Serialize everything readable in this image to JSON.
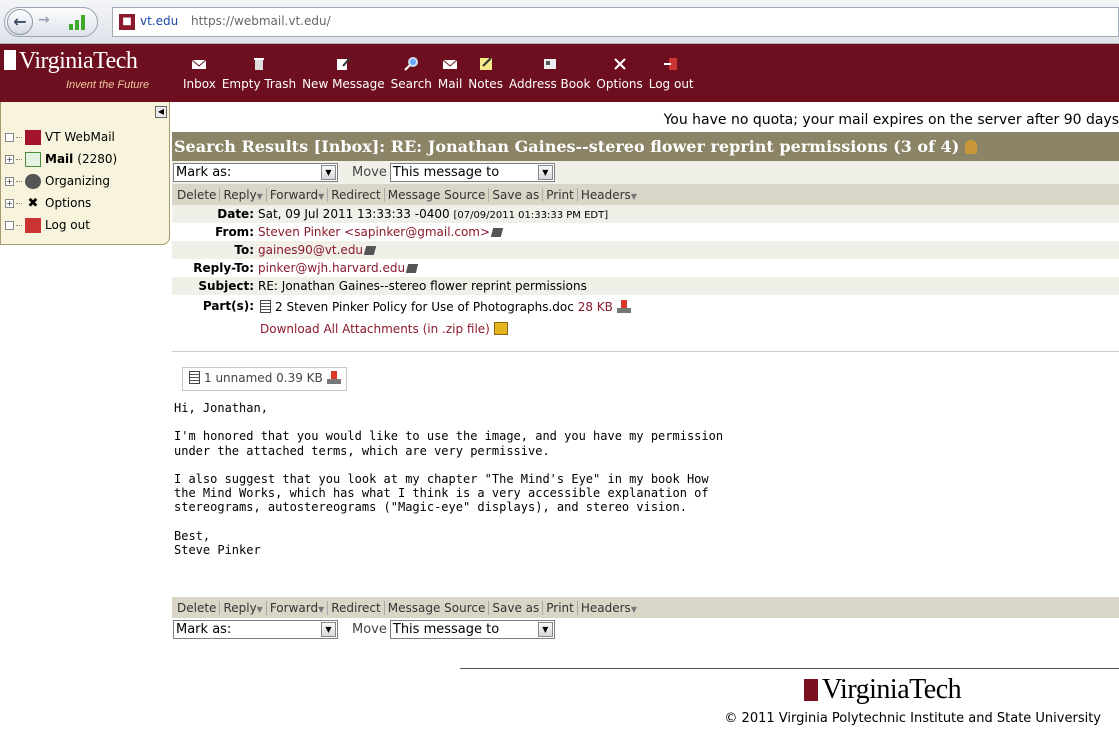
{
  "browser": {
    "site_domain": "vt.edu",
    "url": "https://webmail.vt.edu/"
  },
  "header": {
    "logo_text": "VirginiaTech",
    "tagline": "Invent the Future",
    "toolbar": [
      {
        "label": "Inbox",
        "icon": "envelope-icon"
      },
      {
        "label": "Empty Trash",
        "icon": "trash-icon"
      },
      {
        "label": "New Message",
        "icon": "compose-icon"
      },
      {
        "label": "Search",
        "icon": "search-icon"
      },
      {
        "label": "Mail",
        "icon": "mail-icon"
      },
      {
        "label": "Notes",
        "icon": "notes-icon"
      },
      {
        "label": "Address Book",
        "icon": "address-book-icon"
      },
      {
        "label": "Options",
        "icon": "options-icon"
      },
      {
        "label": "Log out",
        "icon": "logout-icon"
      }
    ]
  },
  "sidebar": {
    "items": [
      {
        "label": "VT WebMail",
        "count": ""
      },
      {
        "label": "Mail",
        "count": "(2280)"
      },
      {
        "label": "Organizing",
        "count": ""
      },
      {
        "label": "Options",
        "count": ""
      },
      {
        "label": "Log out",
        "count": ""
      }
    ]
  },
  "main": {
    "quota_notice": "You have no quota; your mail expires on the server after 90 days",
    "title": "Search Results [Inbox]: RE: Jonathan Gaines--stereo flower reprint permissions (3 of 4)",
    "mark_as_label": "Mark as:",
    "move_label": "Move",
    "move_target": "This message to",
    "actions": [
      "Delete",
      "Reply",
      "Forward",
      "Redirect",
      "Message Source",
      "Save as",
      "Print",
      "Headers"
    ],
    "actions_with_menu": [
      false,
      true,
      true,
      false,
      false,
      false,
      false,
      true
    ]
  },
  "message": {
    "date_label": "Date:",
    "date": "Sat, 09 Jul 2011 13:33:33 -0400",
    "date_local": "[07/09/2011 01:33:33 PM EDT]",
    "from_label": "From:",
    "from": "Steven Pinker <sapinker@gmail.com>",
    "to_label": "To:",
    "to": "gaines90@vt.edu",
    "reply_to_label": "Reply-To:",
    "reply_to": "pinker@wjh.harvard.edu",
    "subject_label": "Subject:",
    "subject": "RE: Jonathan Gaines--stereo flower reprint permissions",
    "parts_label": "Part(s):",
    "part_name": "2 Steven Pinker Policy for Use of Photographs.doc",
    "part_size": "28 KB",
    "download_all": "Download All Attachments (in .zip file)",
    "inline_attachment": "1 unnamed 0.39 KB",
    "body": "Hi, Jonathan,\n\nI'm honored that you would like to use the image, and you have my permission\nunder the attached terms, which are very permissive.\n\nI also suggest that you look at my chapter \"The Mind's Eye\" in my book How\nthe Mind Works, which has what I think is a very accessible explanation of\nstereograms, autostereograms (\"Magic-eye\" displays), and stereo vision.\n\nBest,\nSteve Pinker"
  },
  "footer": {
    "logo_text": "VirginiaTech",
    "copyright": "© 2011 Virginia Polytechnic Institute and State University"
  }
}
